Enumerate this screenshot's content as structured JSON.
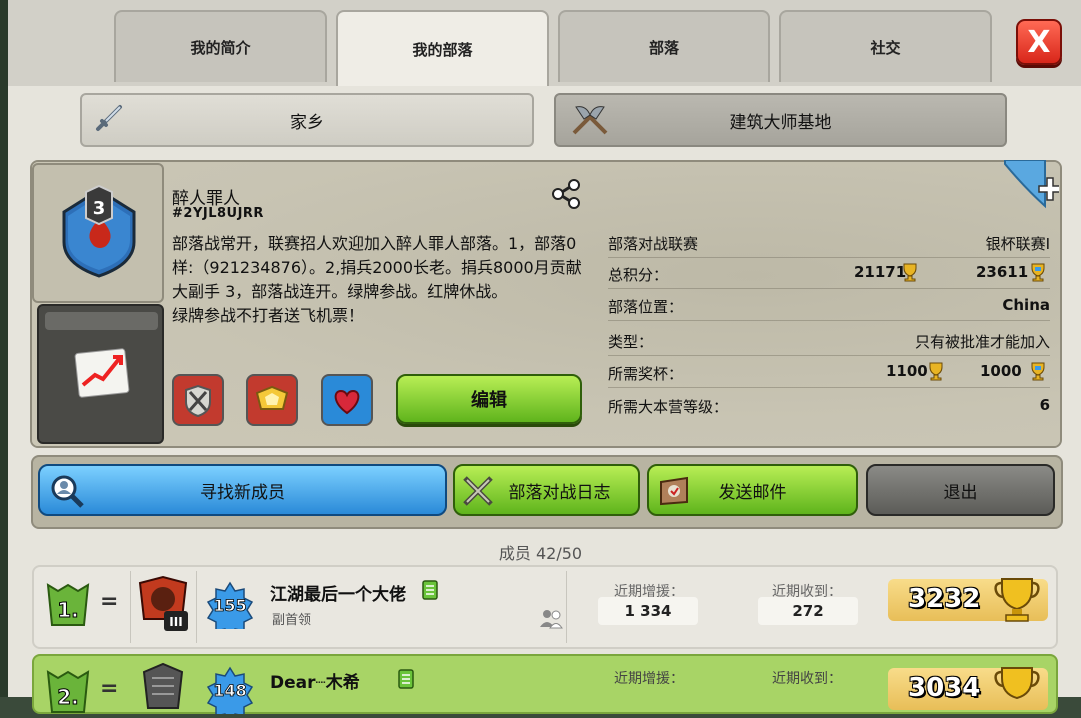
{
  "tabs": [
    "我的简介",
    "我的部落",
    "部落",
    "社交"
  ],
  "active_tab": "我的部落",
  "close_label": "X",
  "subtabs": {
    "home": "家乡",
    "builder": "建筑大师基地"
  },
  "clan": {
    "badge_level": "3",
    "name": "醉人罪人",
    "tag": "#2YJL8UJRR",
    "description": "部落战常开，联赛招人欢迎加入醉人罪人部落。1，部落0样:（921234876）。2,捐兵2000长老。捐兵8000月贡献大副手 3，部落战连开。绿牌参战。红牌休战。\n绿牌参战不打者送飞机票！",
    "edit_label": "编辑"
  },
  "info": {
    "war_league_label": "部落对战联赛",
    "war_league_value": "银杯联赛I",
    "points_label": "总积分：",
    "points_home": "21171",
    "points_builder": "23611",
    "location_label": "部落位置：",
    "location_value": "China",
    "type_label": "类型：",
    "type_value": "只有被批准才能加入",
    "req_trophies_label": "所需奖杯：",
    "req_trophies_home": "1100",
    "req_trophies_builder": "1000",
    "req_th_label": "所需大本营等级：",
    "req_th_value": "6"
  },
  "actions": {
    "find": "寻找新成员",
    "warlog": "部落对战日志",
    "mail": "发送邮件",
    "leave": "退出"
  },
  "members_title": "成员 42/50",
  "members": [
    {
      "rank": "1.",
      "change": "=",
      "th_level": "III",
      "exp": "155",
      "name": "江湖最后一个大佬",
      "role": "副首领",
      "donated_label": "近期增援：",
      "donated": "1 334",
      "received_label": "近期收到：",
      "received": "272",
      "trophies": "3232"
    },
    {
      "rank": "2.",
      "change": "=",
      "exp": "148",
      "name": "Dear┈木希",
      "donated_label": "近期增援：",
      "received_label": "近期收到：",
      "trophies": "3034"
    }
  ],
  "colors": {
    "accent_green": "#5fb41c",
    "accent_blue": "#2a8ad8",
    "close_red": "#d8261a",
    "gold": "#e8be58"
  }
}
